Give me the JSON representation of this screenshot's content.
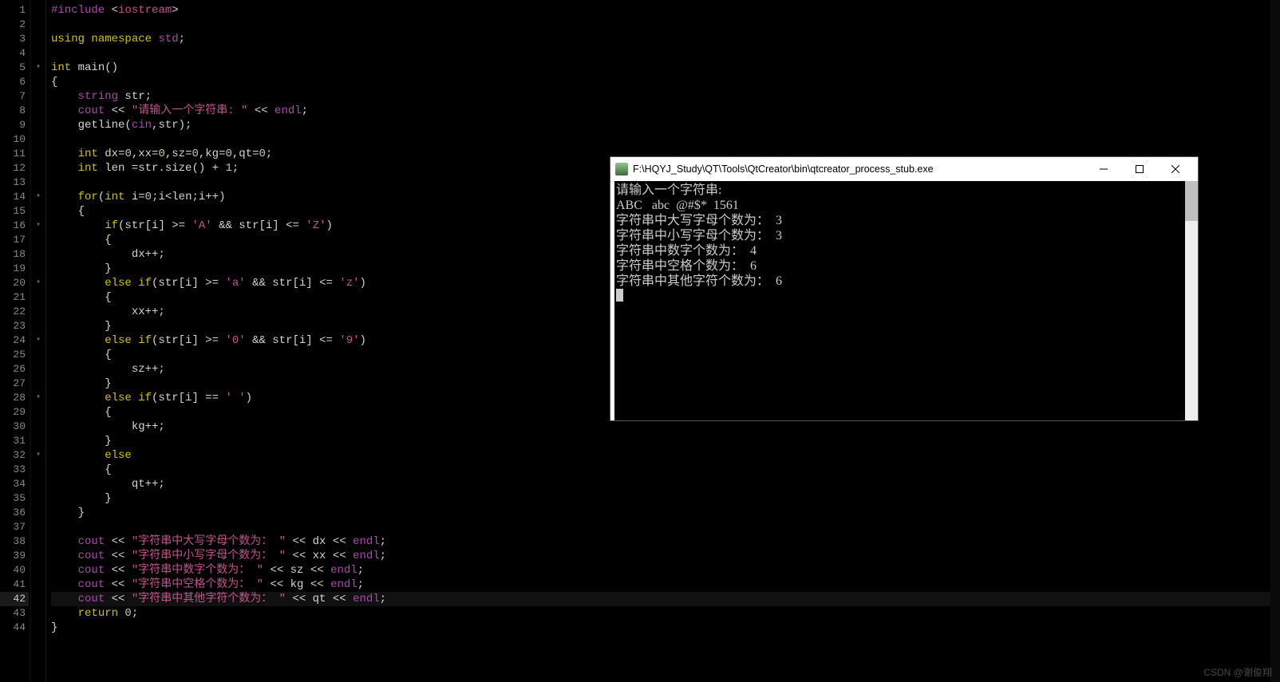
{
  "editor": {
    "lines": [
      {
        "n": 1,
        "fold": "",
        "seg": [
          [
            "pp",
            "#include "
          ],
          [
            "op",
            "<"
          ],
          [
            "str",
            "iostream"
          ],
          [
            "op",
            ">"
          ]
        ]
      },
      {
        "n": 2,
        "fold": "",
        "seg": []
      },
      {
        "n": 3,
        "fold": "",
        "seg": [
          [
            "kw",
            "using "
          ],
          [
            "kw",
            "namespace "
          ],
          [
            "pp",
            "std"
          ],
          [
            "op",
            ";"
          ]
        ]
      },
      {
        "n": 4,
        "fold": "",
        "seg": []
      },
      {
        "n": 5,
        "fold": "▾",
        "seg": [
          [
            "kw",
            "int "
          ],
          [
            "fn",
            "main"
          ],
          [
            "op",
            "()"
          ]
        ]
      },
      {
        "n": 6,
        "fold": "",
        "seg": [
          [
            "op",
            "{"
          ]
        ]
      },
      {
        "n": 7,
        "fold": "",
        "seg": [
          [
            "op",
            "    "
          ],
          [
            "pp",
            "string"
          ],
          [
            "op",
            " str;"
          ]
        ]
      },
      {
        "n": 8,
        "fold": "",
        "seg": [
          [
            "op",
            "    "
          ],
          [
            "pp",
            "cout"
          ],
          [
            "op",
            " << "
          ],
          [
            "str",
            "\"请输入一个字符串: \""
          ],
          [
            "op",
            " << "
          ],
          [
            "pp",
            "endl"
          ],
          [
            "op",
            ";"
          ]
        ]
      },
      {
        "n": 9,
        "fold": "",
        "seg": [
          [
            "op",
            "    "
          ],
          [
            "fn",
            "getline"
          ],
          [
            "op",
            "("
          ],
          [
            "pp",
            "cin"
          ],
          [
            "op",
            ",str);"
          ]
        ]
      },
      {
        "n": 10,
        "fold": "",
        "seg": []
      },
      {
        "n": 11,
        "fold": "",
        "seg": [
          [
            "op",
            "    "
          ],
          [
            "kw",
            "int "
          ],
          [
            "op",
            "dx="
          ],
          [
            "num",
            "0"
          ],
          [
            "op",
            ",xx="
          ],
          [
            "num",
            "0"
          ],
          [
            "op",
            ",sz="
          ],
          [
            "num",
            "0"
          ],
          [
            "op",
            ",kg="
          ],
          [
            "num",
            "0"
          ],
          [
            "op",
            ",qt="
          ],
          [
            "num",
            "0"
          ],
          [
            "op",
            ";"
          ]
        ]
      },
      {
        "n": 12,
        "fold": "",
        "seg": [
          [
            "op",
            "    "
          ],
          [
            "kw",
            "int "
          ],
          [
            "op",
            "len =str."
          ],
          [
            "fn",
            "size"
          ],
          [
            "op",
            "() + "
          ],
          [
            "num",
            "1"
          ],
          [
            "op",
            ";"
          ]
        ]
      },
      {
        "n": 13,
        "fold": "",
        "seg": []
      },
      {
        "n": 14,
        "fold": "▾",
        "seg": [
          [
            "op",
            "    "
          ],
          [
            "kw",
            "for"
          ],
          [
            "op",
            "("
          ],
          [
            "kw",
            "int "
          ],
          [
            "op",
            "i="
          ],
          [
            "num",
            "0"
          ],
          [
            "op",
            ";i<len;i++)"
          ]
        ]
      },
      {
        "n": 15,
        "fold": "",
        "seg": [
          [
            "op",
            "    {"
          ]
        ]
      },
      {
        "n": 16,
        "fold": "▾",
        "seg": [
          [
            "op",
            "        "
          ],
          [
            "kw",
            "if"
          ],
          [
            "op",
            "(str[i] >= "
          ],
          [
            "str",
            "'A'"
          ],
          [
            "op",
            " && str[i] <= "
          ],
          [
            "str",
            "'Z'"
          ],
          [
            "op",
            ")"
          ]
        ]
      },
      {
        "n": 17,
        "fold": "",
        "seg": [
          [
            "op",
            "        {"
          ]
        ]
      },
      {
        "n": 18,
        "fold": "",
        "seg": [
          [
            "op",
            "            dx++;"
          ]
        ]
      },
      {
        "n": 19,
        "fold": "",
        "seg": [
          [
            "op",
            "        }"
          ]
        ]
      },
      {
        "n": 20,
        "fold": "▾",
        "seg": [
          [
            "op",
            "        "
          ],
          [
            "kw",
            "else if"
          ],
          [
            "op",
            "(str[i] >= "
          ],
          [
            "str",
            "'a'"
          ],
          [
            "op",
            " && str[i] <= "
          ],
          [
            "str",
            "'z'"
          ],
          [
            "op",
            ")"
          ]
        ]
      },
      {
        "n": 21,
        "fold": "",
        "seg": [
          [
            "op",
            "        {"
          ]
        ]
      },
      {
        "n": 22,
        "fold": "",
        "seg": [
          [
            "op",
            "            xx++;"
          ]
        ]
      },
      {
        "n": 23,
        "fold": "",
        "seg": [
          [
            "op",
            "        }"
          ]
        ]
      },
      {
        "n": 24,
        "fold": "▾",
        "seg": [
          [
            "op",
            "        "
          ],
          [
            "kw",
            "else if"
          ],
          [
            "op",
            "(str[i] >= "
          ],
          [
            "str",
            "'0'"
          ],
          [
            "op",
            " && str[i] <= "
          ],
          [
            "str",
            "'9'"
          ],
          [
            "op",
            ")"
          ]
        ]
      },
      {
        "n": 25,
        "fold": "",
        "seg": [
          [
            "op",
            "        {"
          ]
        ]
      },
      {
        "n": 26,
        "fold": "",
        "seg": [
          [
            "op",
            "            sz++;"
          ]
        ]
      },
      {
        "n": 27,
        "fold": "",
        "seg": [
          [
            "op",
            "        }"
          ]
        ]
      },
      {
        "n": 28,
        "fold": "▾",
        "seg": [
          [
            "op",
            "        "
          ],
          [
            "kw",
            "else if"
          ],
          [
            "op",
            "(str[i] == "
          ],
          [
            "str",
            "' '"
          ],
          [
            "op",
            ")"
          ]
        ]
      },
      {
        "n": 29,
        "fold": "",
        "seg": [
          [
            "op",
            "        {"
          ]
        ]
      },
      {
        "n": 30,
        "fold": "",
        "seg": [
          [
            "op",
            "            kg++;"
          ]
        ]
      },
      {
        "n": 31,
        "fold": "",
        "seg": [
          [
            "op",
            "        }"
          ]
        ]
      },
      {
        "n": 32,
        "fold": "▾",
        "seg": [
          [
            "op",
            "        "
          ],
          [
            "kw",
            "else"
          ]
        ]
      },
      {
        "n": 33,
        "fold": "",
        "seg": [
          [
            "op",
            "        {"
          ]
        ]
      },
      {
        "n": 34,
        "fold": "",
        "seg": [
          [
            "op",
            "            qt++;"
          ]
        ]
      },
      {
        "n": 35,
        "fold": "",
        "seg": [
          [
            "op",
            "        }"
          ]
        ]
      },
      {
        "n": 36,
        "fold": "",
        "seg": [
          [
            "op",
            "    }"
          ]
        ]
      },
      {
        "n": 37,
        "fold": "",
        "seg": []
      },
      {
        "n": 38,
        "fold": "",
        "seg": [
          [
            "op",
            "    "
          ],
          [
            "pp",
            "cout"
          ],
          [
            "op",
            " << "
          ],
          [
            "str",
            "\"字符串中大写字母个数为： \""
          ],
          [
            "op",
            " << dx << "
          ],
          [
            "pp",
            "endl"
          ],
          [
            "op",
            ";"
          ]
        ]
      },
      {
        "n": 39,
        "fold": "",
        "seg": [
          [
            "op",
            "    "
          ],
          [
            "pp",
            "cout"
          ],
          [
            "op",
            " << "
          ],
          [
            "str",
            "\"字符串中小写字母个数为： \""
          ],
          [
            "op",
            " << xx << "
          ],
          [
            "pp",
            "endl"
          ],
          [
            "op",
            ";"
          ]
        ]
      },
      {
        "n": 40,
        "fold": "",
        "seg": [
          [
            "op",
            "    "
          ],
          [
            "pp",
            "cout"
          ],
          [
            "op",
            " << "
          ],
          [
            "str",
            "\"字符串中数字个数为： \""
          ],
          [
            "op",
            " << sz << "
          ],
          [
            "pp",
            "endl"
          ],
          [
            "op",
            ";"
          ]
        ]
      },
      {
        "n": 41,
        "fold": "",
        "seg": [
          [
            "op",
            "    "
          ],
          [
            "pp",
            "cout"
          ],
          [
            "op",
            " << "
          ],
          [
            "str",
            "\"字符串中空格个数为： \""
          ],
          [
            "op",
            " << kg << "
          ],
          [
            "pp",
            "endl"
          ],
          [
            "op",
            ";"
          ]
        ]
      },
      {
        "n": 42,
        "fold": "",
        "seg": [
          [
            "op",
            "    "
          ],
          [
            "pp",
            "cout"
          ],
          [
            "op",
            " << "
          ],
          [
            "str",
            "\"字符串中其他字符个数为： \""
          ],
          [
            "op",
            " << qt << "
          ],
          [
            "pp",
            "endl"
          ],
          [
            "op",
            ";"
          ]
        ],
        "hl": true
      },
      {
        "n": 43,
        "fold": "",
        "seg": [
          [
            "op",
            "    "
          ],
          [
            "kw",
            "return "
          ],
          [
            "num",
            "0"
          ],
          [
            "op",
            ";"
          ]
        ]
      },
      {
        "n": 44,
        "fold": "",
        "seg": [
          [
            "op",
            "}"
          ]
        ]
      }
    ]
  },
  "console": {
    "title": "F:\\HQYJ_Study\\QT\\Tools\\QtCreator\\bin\\qtcreator_process_stub.exe",
    "lines": [
      "请输入一个字符串:",
      "ABC   abc  @#$*  1561",
      "字符串中大写字母个数为：  3",
      "字符串中小写字母个数为：  3",
      "字符串中数字个数为：  4",
      "字符串中空格个数为：  6",
      "字符串中其他字符个数为：  6"
    ]
  },
  "watermark": "CSDN @谢俊翔"
}
